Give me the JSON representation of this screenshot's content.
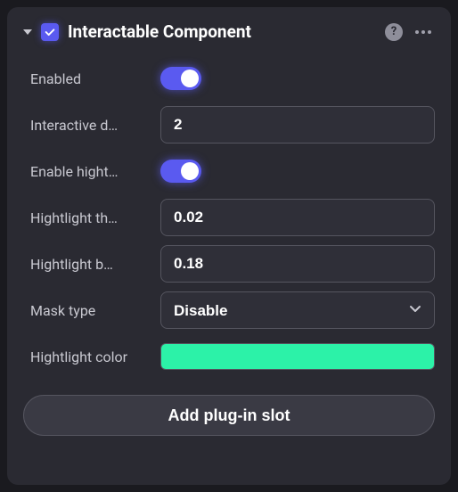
{
  "header": {
    "title": "Interactable Component",
    "checked": true
  },
  "fields": {
    "enabled": {
      "label": "Enabled",
      "value": true
    },
    "interactive_distance": {
      "label": "Interactive d…",
      "value": "2"
    },
    "enable_highlight": {
      "label": "Enable hight…",
      "value": true
    },
    "highlight_thickness": {
      "label": "Hightlight th…",
      "value": "0.02"
    },
    "highlight_blur": {
      "label": "Hightlight b…",
      "value": "0.18"
    },
    "mask_type": {
      "label": "Mask type",
      "value": "Disable",
      "options": [
        "Disable"
      ]
    },
    "highlight_color": {
      "label": "Hightlight color",
      "value": "#2cf2a8"
    }
  },
  "add_button": "Add plug-in slot"
}
